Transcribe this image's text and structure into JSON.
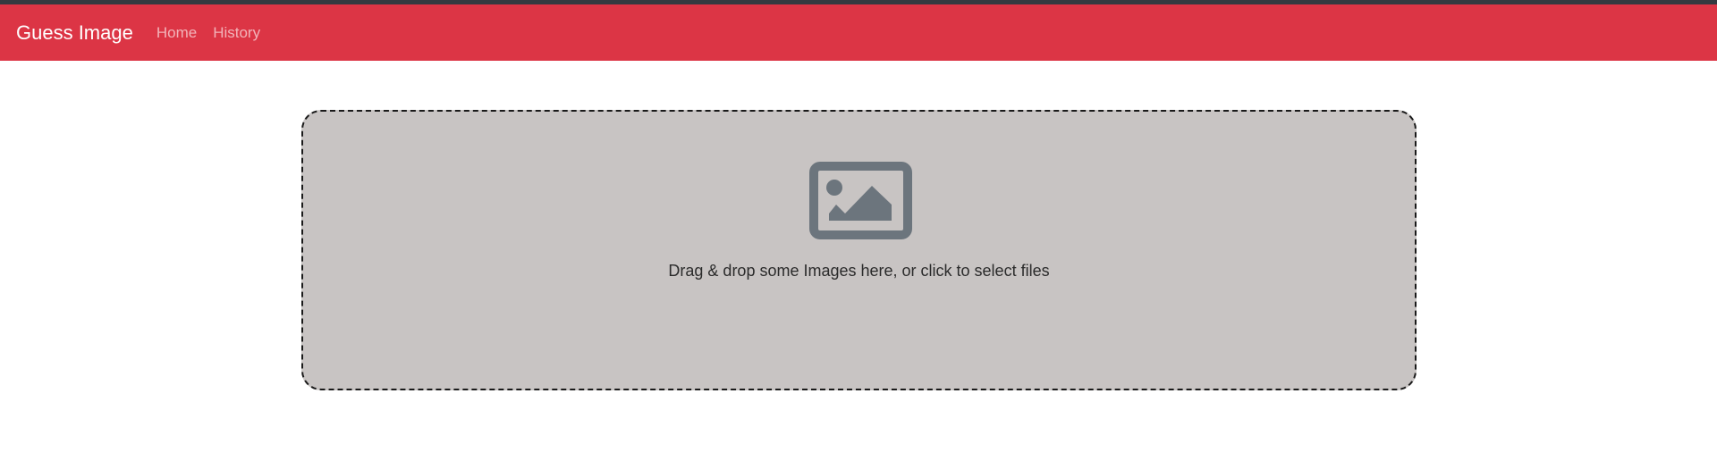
{
  "navbar": {
    "brand": "Guess Image",
    "links": [
      {
        "label": "Home"
      },
      {
        "label": "History"
      }
    ],
    "color": "#dc3545"
  },
  "dropzone": {
    "icon": "image-icon",
    "instructions": "Drag & drop some Images here, or click to select files",
    "background": "#c8c4c3"
  }
}
